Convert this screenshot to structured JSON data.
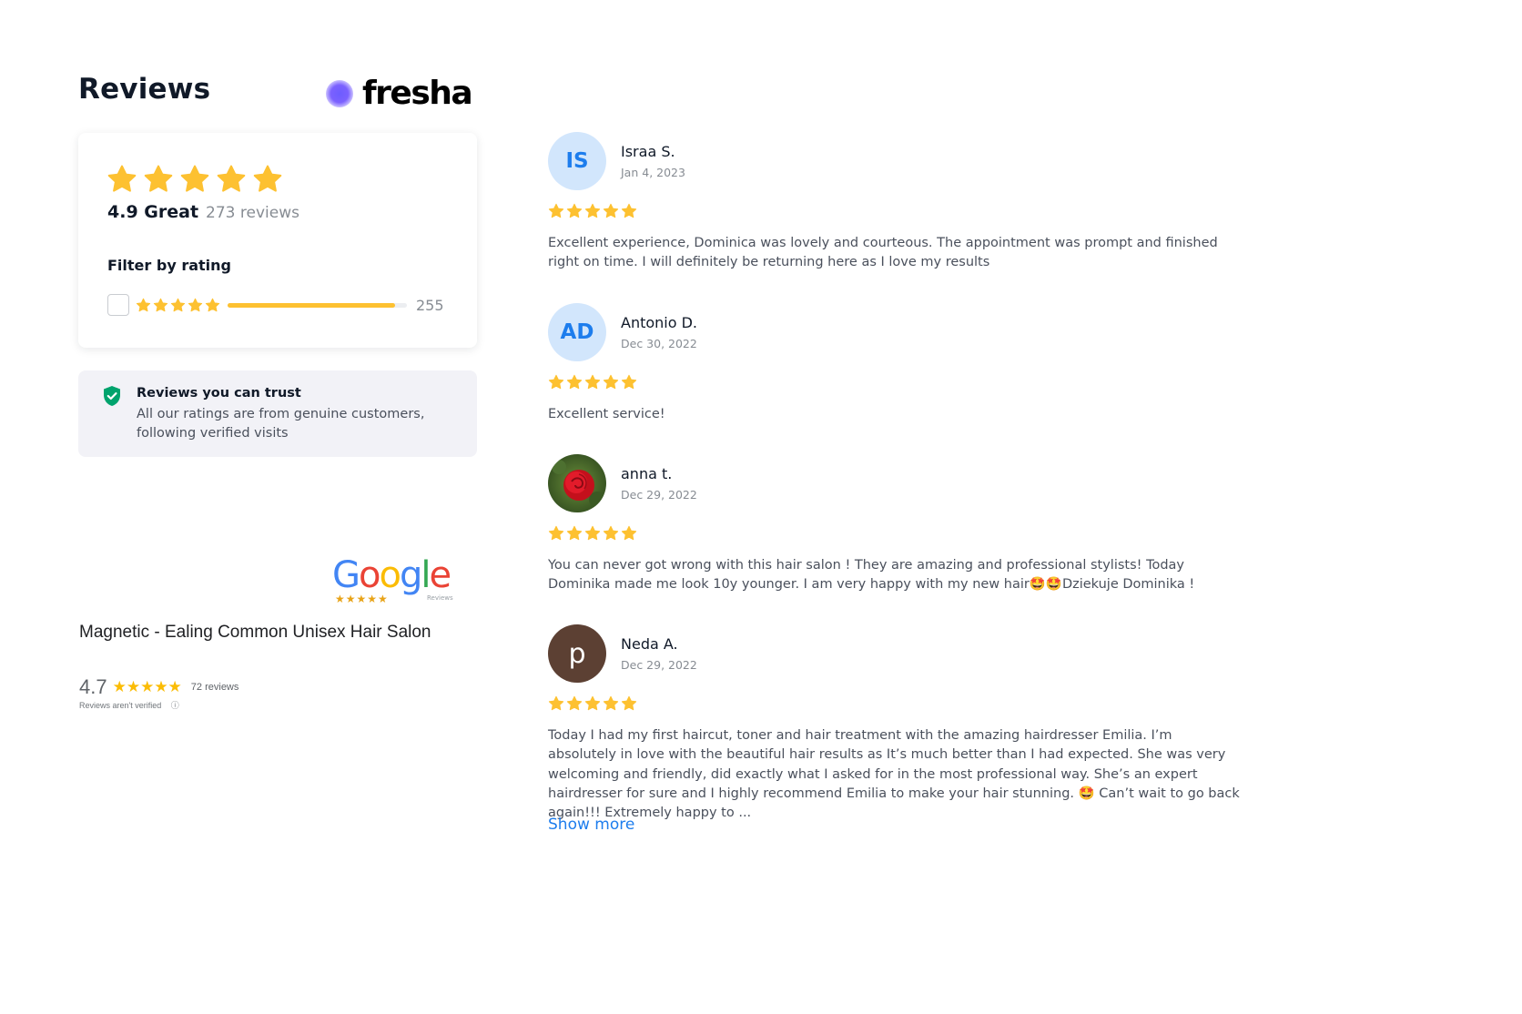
{
  "header": {
    "title": "Reviews",
    "brand": "fresha"
  },
  "summary": {
    "stars": 5,
    "score_label": "4.9 Great",
    "count_label": "273 reviews",
    "filter_title": "Filter by rating",
    "filters": [
      {
        "stars": 5,
        "count": "255",
        "fraction": 0.934
      }
    ]
  },
  "trust": {
    "title": "Reviews you can trust",
    "body": "All our ratings are from genuine customers, following verified visits"
  },
  "google": {
    "logo_word": "Google",
    "logo_sub": "Reviews",
    "salon_name": "Magnetic - Ealing Common Unisex Hair Salon",
    "score": "4.7",
    "rating_stars": "★★★★★",
    "count": "72 reviews",
    "verify_note": "Reviews aren't verified"
  },
  "reviews": [
    {
      "initials": "IS",
      "name": "Israa S.",
      "date": "Jan 4, 2023",
      "stars": 5,
      "text": "Excellent experience, Dominica was lovely and courteous. The appointment was prompt and finished right on time. I will definitely be returning here as I love my results"
    },
    {
      "initials": "AD",
      "name": "Antonio D.",
      "date": "Dec 30, 2022",
      "stars": 5,
      "text": "Excellent service!"
    },
    {
      "initials": "",
      "name": "anna t.",
      "date": "Dec 29, 2022",
      "stars": 5,
      "text": "You can never got wrong with this hair salon ! They are amazing and professional stylists! Today Dominika made me look 10y younger. I am very happy with my new hair🤩🤩Dziekuje Dominika !"
    },
    {
      "initials": "p",
      "name": "Neda A.",
      "date": "Dec 29, 2022",
      "stars": 5,
      "text": "Today I had my first haircut, toner and hair treatment with the amazing hairdresser Emilia. I’m absolutely in love with the beautiful hair results as It’s much better than I had expected. She was very welcoming and friendly, did exactly what I asked for in the most professional way. She’s an expert hairdresser for sure and I highly recommend Emilia to make your hair stunning. 🤩 Can’t wait to go back again!!! Extremely happy to ...",
      "show_more": "Show more"
    }
  ],
  "colors": {
    "star": "#fdc131",
    "accent": "#1d7ded",
    "trust_green": "#00a36d"
  }
}
